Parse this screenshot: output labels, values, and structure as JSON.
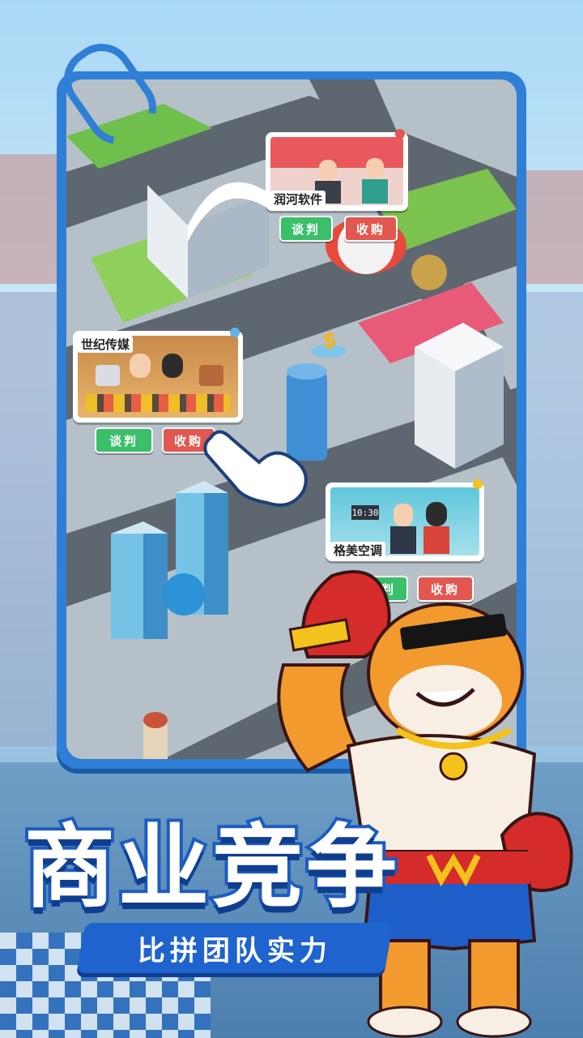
{
  "cards": [
    {
      "title": "润河软件",
      "negotiate": "谈判",
      "acquire": "收购"
    },
    {
      "title": "世纪传媒",
      "negotiate": "谈判",
      "acquire": "收购"
    },
    {
      "title": "格美空调",
      "negotiate": "谈判",
      "acquire": "收购"
    }
  ],
  "card3_clock": "10:30",
  "headline": "商业竞争",
  "subheadline": "比拼团队实力",
  "colors": {
    "frame": "#2f7fd6",
    "green_button": "#3bbf6b",
    "red_button": "#e2574f",
    "title_stroke": "#1d5cc0"
  }
}
